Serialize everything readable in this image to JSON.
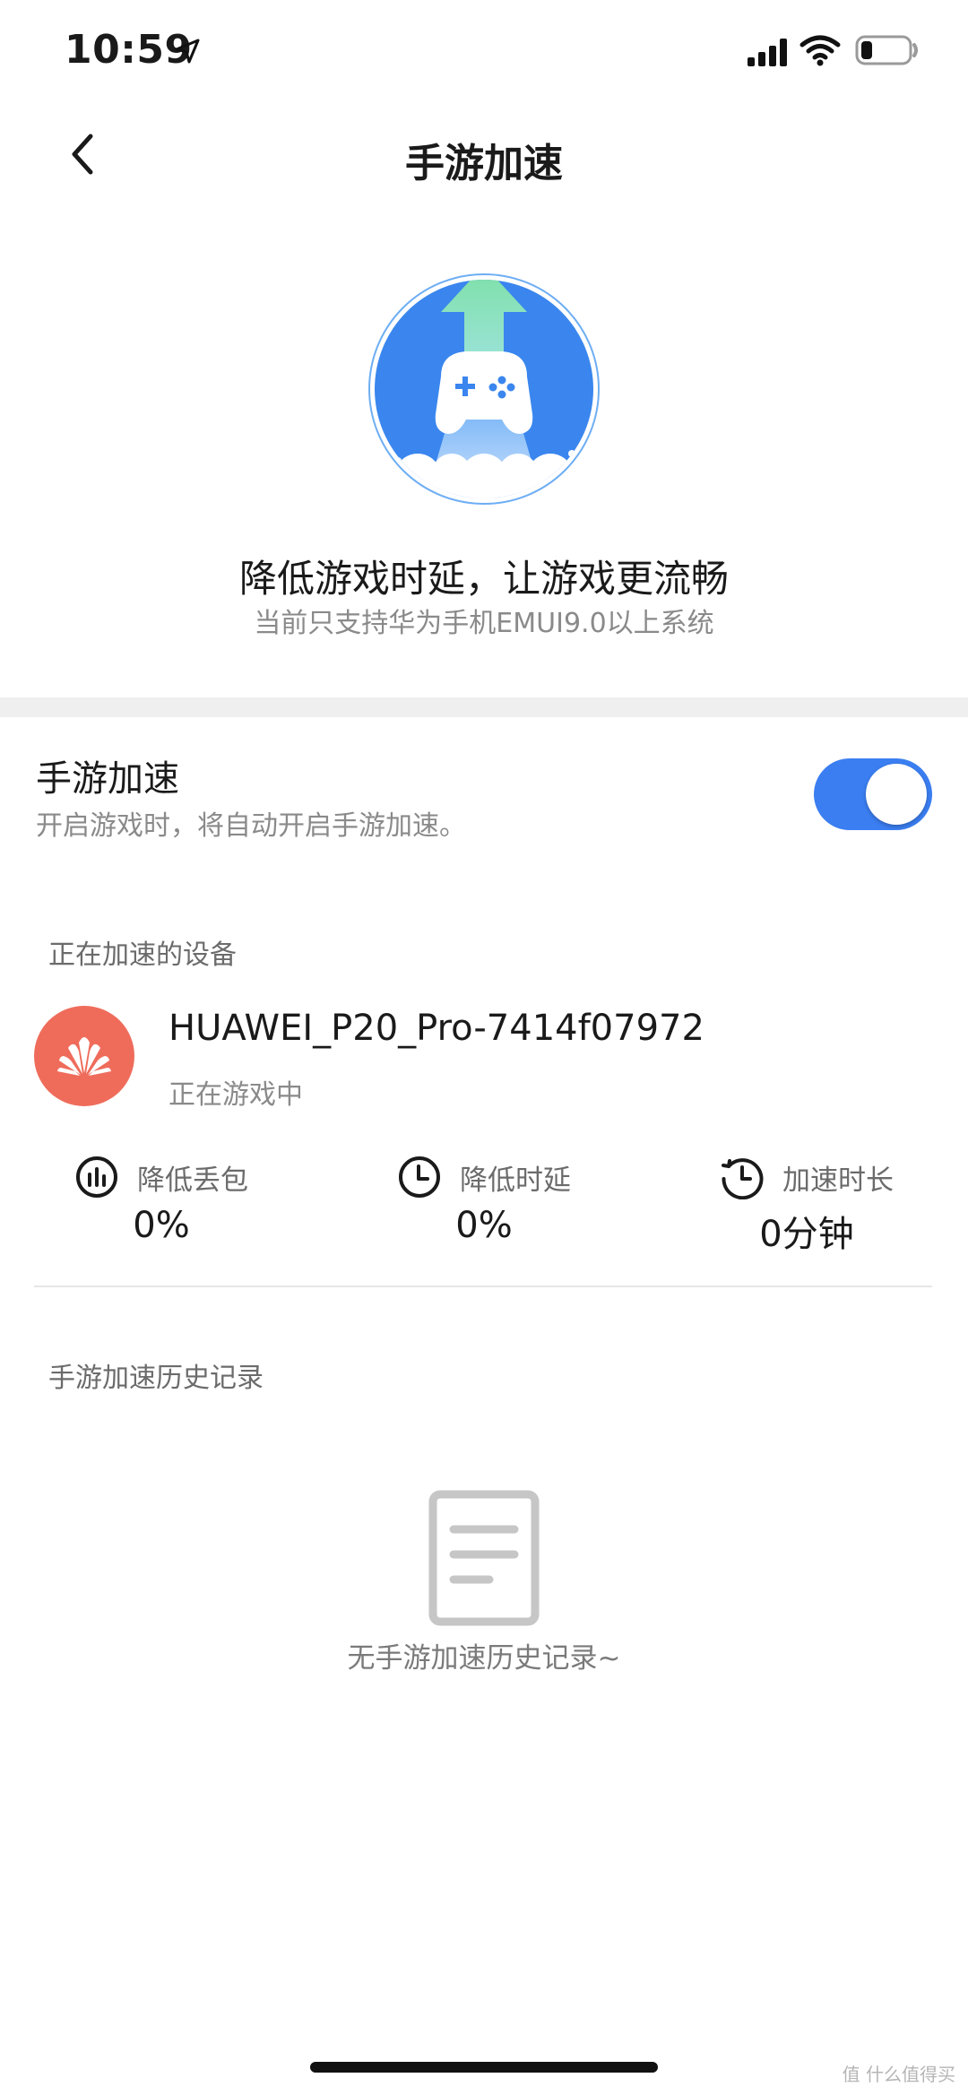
{
  "status_bar": {
    "time": "10:59",
    "icons": [
      "location-arrow-icon",
      "cellular-signal-icon",
      "wifi-icon",
      "battery-icon"
    ]
  },
  "nav": {
    "back_icon": "chevron-left-icon",
    "title": "手游加速"
  },
  "hero": {
    "logo_icon": "game-controller-rocket-icon",
    "headline": "降低游戏时延，让游戏更流畅",
    "subline": "当前只支持华为手机EMUI9.0以上系统"
  },
  "toggle_row": {
    "title": "手游加速",
    "description": "开启游戏时，将自动开启手游加速。",
    "enabled": true
  },
  "devices": {
    "section_label": "正在加速的设备",
    "items": [
      {
        "avatar_icon": "huawei-logo-icon",
        "name": "HUAWEI_P20_Pro-7414f07972",
        "status": "正在游戏中"
      }
    ]
  },
  "stats": [
    {
      "icon": "bar-chart-circle-icon",
      "label": "降低丢包",
      "value": "0%"
    },
    {
      "icon": "clock-icon",
      "label": "降低时延",
      "value": "0%"
    },
    {
      "icon": "timer-icon",
      "label": "加速时长",
      "value": "0分钟"
    }
  ],
  "history": {
    "section_label": "手游加速历史记录",
    "empty_icon": "document-icon",
    "empty_text": "无手游加速历史记录~"
  },
  "watermark": "值 什么值得买",
  "colors": {
    "accent": "#3a7ef1",
    "avatar": "#ef6c5b",
    "secondary_text": "#8a8a8a",
    "divider": "#e6e6e6"
  }
}
